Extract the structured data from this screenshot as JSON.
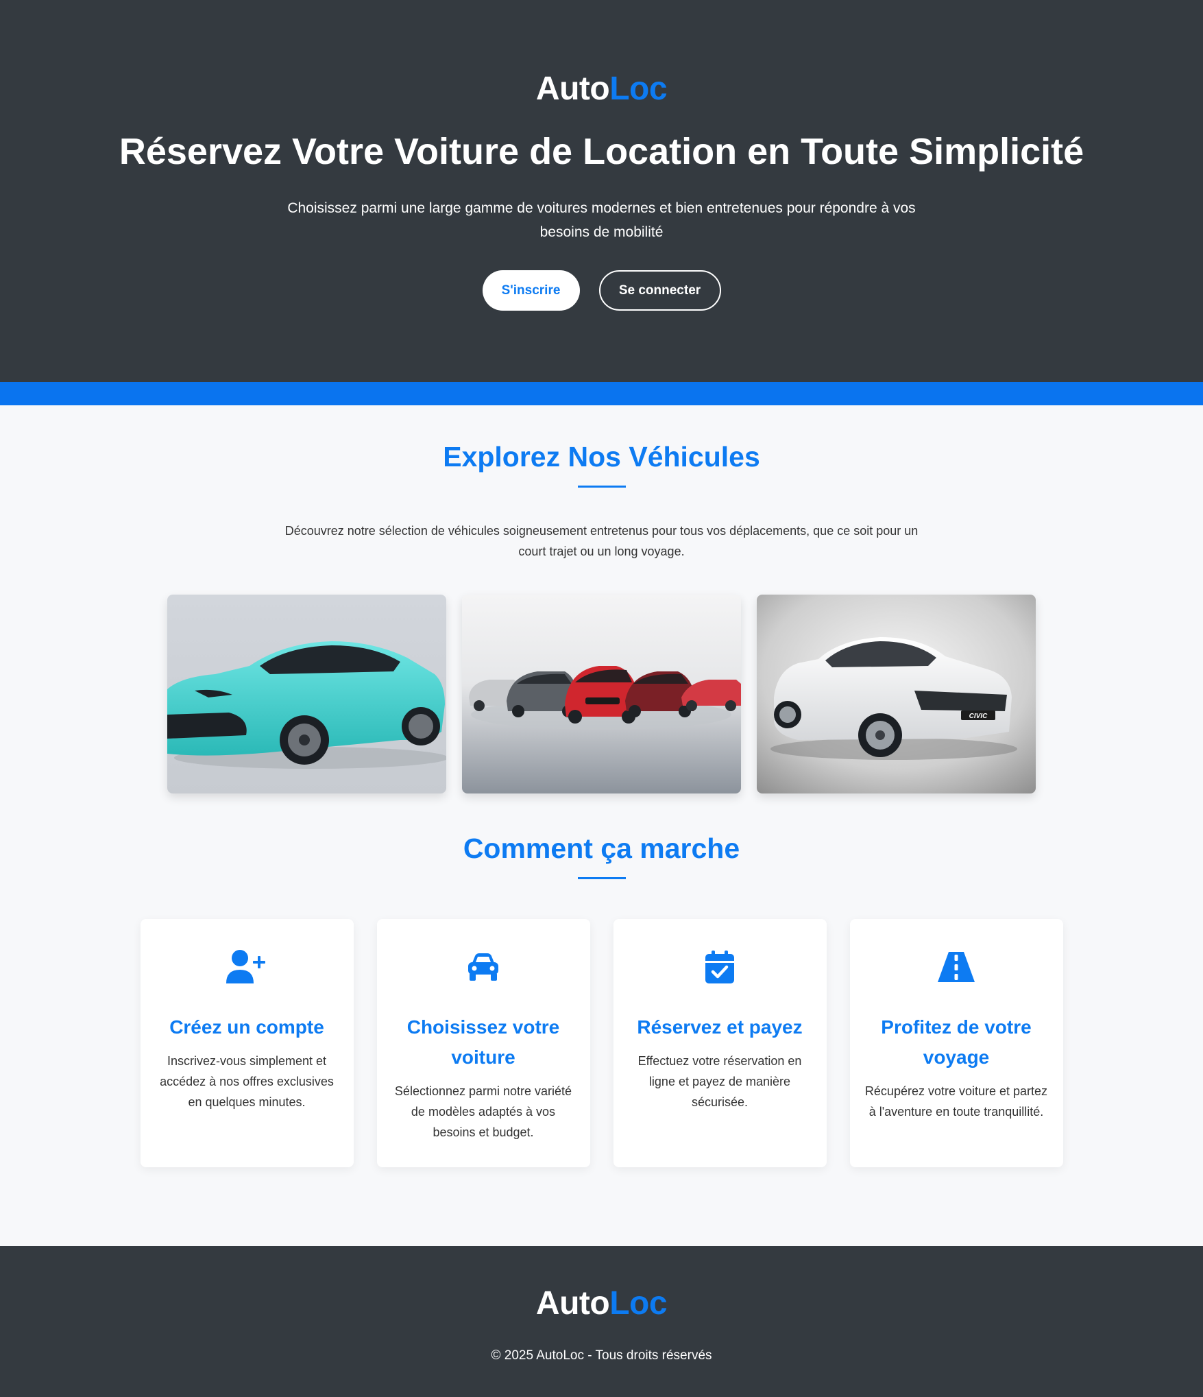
{
  "brand": {
    "part1": "Auto",
    "part2": "Loc"
  },
  "hero": {
    "title": "Réservez Votre Voiture de Location en Toute Simplicité",
    "subtitle": "Choisissez parmi une large gamme de voitures modernes et bien entretenues pour répondre à vos besoins de mobilité",
    "signup_label": "S'inscrire",
    "login_label": "Se connecter"
  },
  "vehicles": {
    "title": "Explorez Nos Véhicules",
    "intro": "Découvrez notre sélection de véhicules soigneusement entretenus pour tous vos déplacements, que ce soit pour un court trajet ou un long voyage.",
    "badge": "CIVIC"
  },
  "how": {
    "title": "Comment ça marche",
    "steps": [
      {
        "icon": "user-plus-icon",
        "title": "Créez un compte",
        "text": "Inscrivez-vous simplement et accédez à nos offres exclusives en quelques minutes."
      },
      {
        "icon": "car-icon",
        "title": "Choisissez votre voiture",
        "text": "Sélectionnez parmi notre variété de modèles adaptés à vos besoins et budget."
      },
      {
        "icon": "calendar-check-icon",
        "title": "Réservez et payez",
        "text": "Effectuez votre réservation en ligne et payez de manière sécurisée."
      },
      {
        "icon": "road-icon",
        "title": "Profitez de votre voyage",
        "text": "Récupérez votre voiture et partez à l'aventure en toute tranquillité."
      }
    ]
  },
  "footer": {
    "copyright": "© 2025 AutoLoc - Tous droits réservés"
  },
  "colors": {
    "accent": "#0d7bf2",
    "dark": "#343a40",
    "stripe": "#0a74ef"
  }
}
